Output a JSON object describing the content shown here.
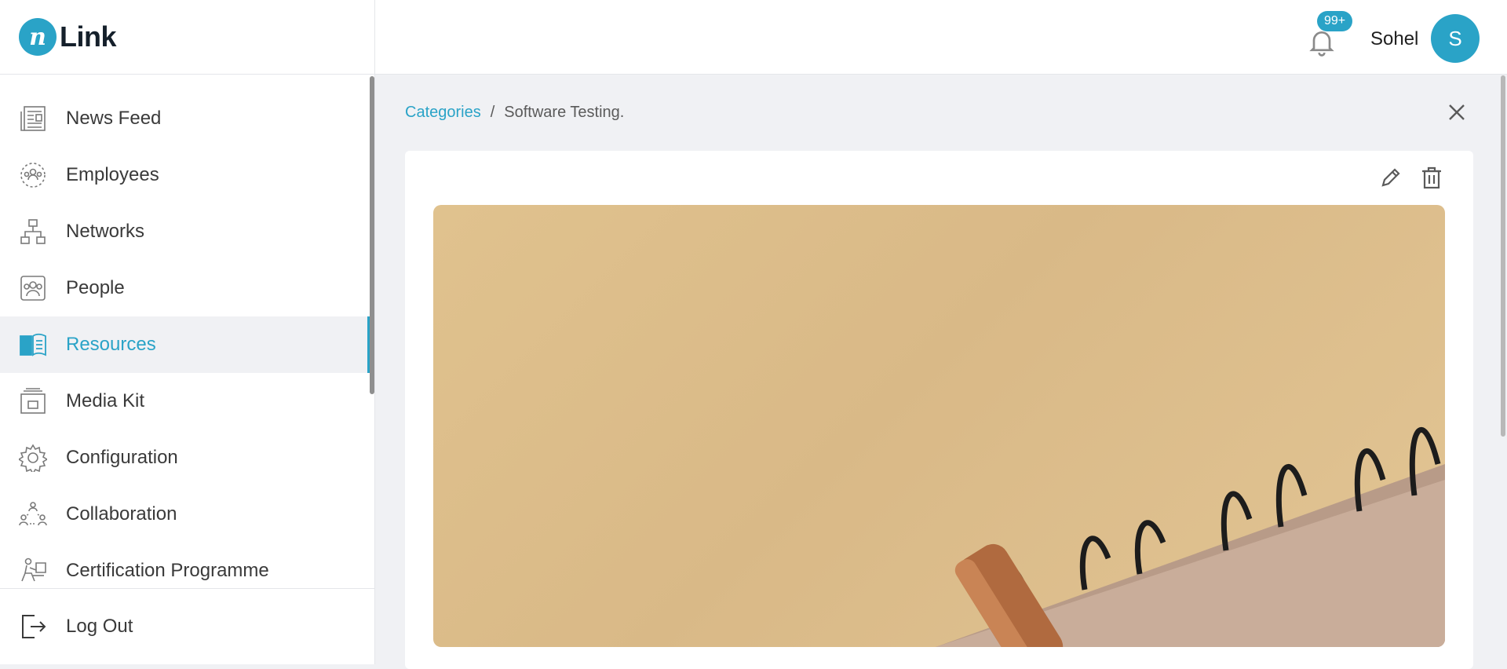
{
  "app": {
    "logo_text": "Link",
    "logo_letter": "n"
  },
  "header": {
    "notification_count": "99+",
    "username": "Sohel",
    "avatar_initial": "S"
  },
  "sidebar": {
    "items": [
      {
        "label": "News Feed",
        "icon": "newspaper-icon"
      },
      {
        "label": "Employees",
        "icon": "employees-icon"
      },
      {
        "label": "Networks",
        "icon": "network-icon"
      },
      {
        "label": "People",
        "icon": "people-icon"
      },
      {
        "label": "Resources",
        "icon": "book-icon",
        "active": true
      },
      {
        "label": "Media Kit",
        "icon": "media-kit-icon"
      },
      {
        "label": "Configuration",
        "icon": "gear-icon"
      },
      {
        "label": "Collaboration",
        "icon": "collaboration-icon"
      },
      {
        "label": "Certification Programme",
        "icon": "certification-icon"
      }
    ],
    "logout_label": "Log Out"
  },
  "breadcrumb": {
    "parent": "Categories",
    "separator": "/",
    "current": "Software Testing."
  },
  "colors": {
    "accent": "#2aa3c7",
    "background": "#f0f1f4"
  }
}
